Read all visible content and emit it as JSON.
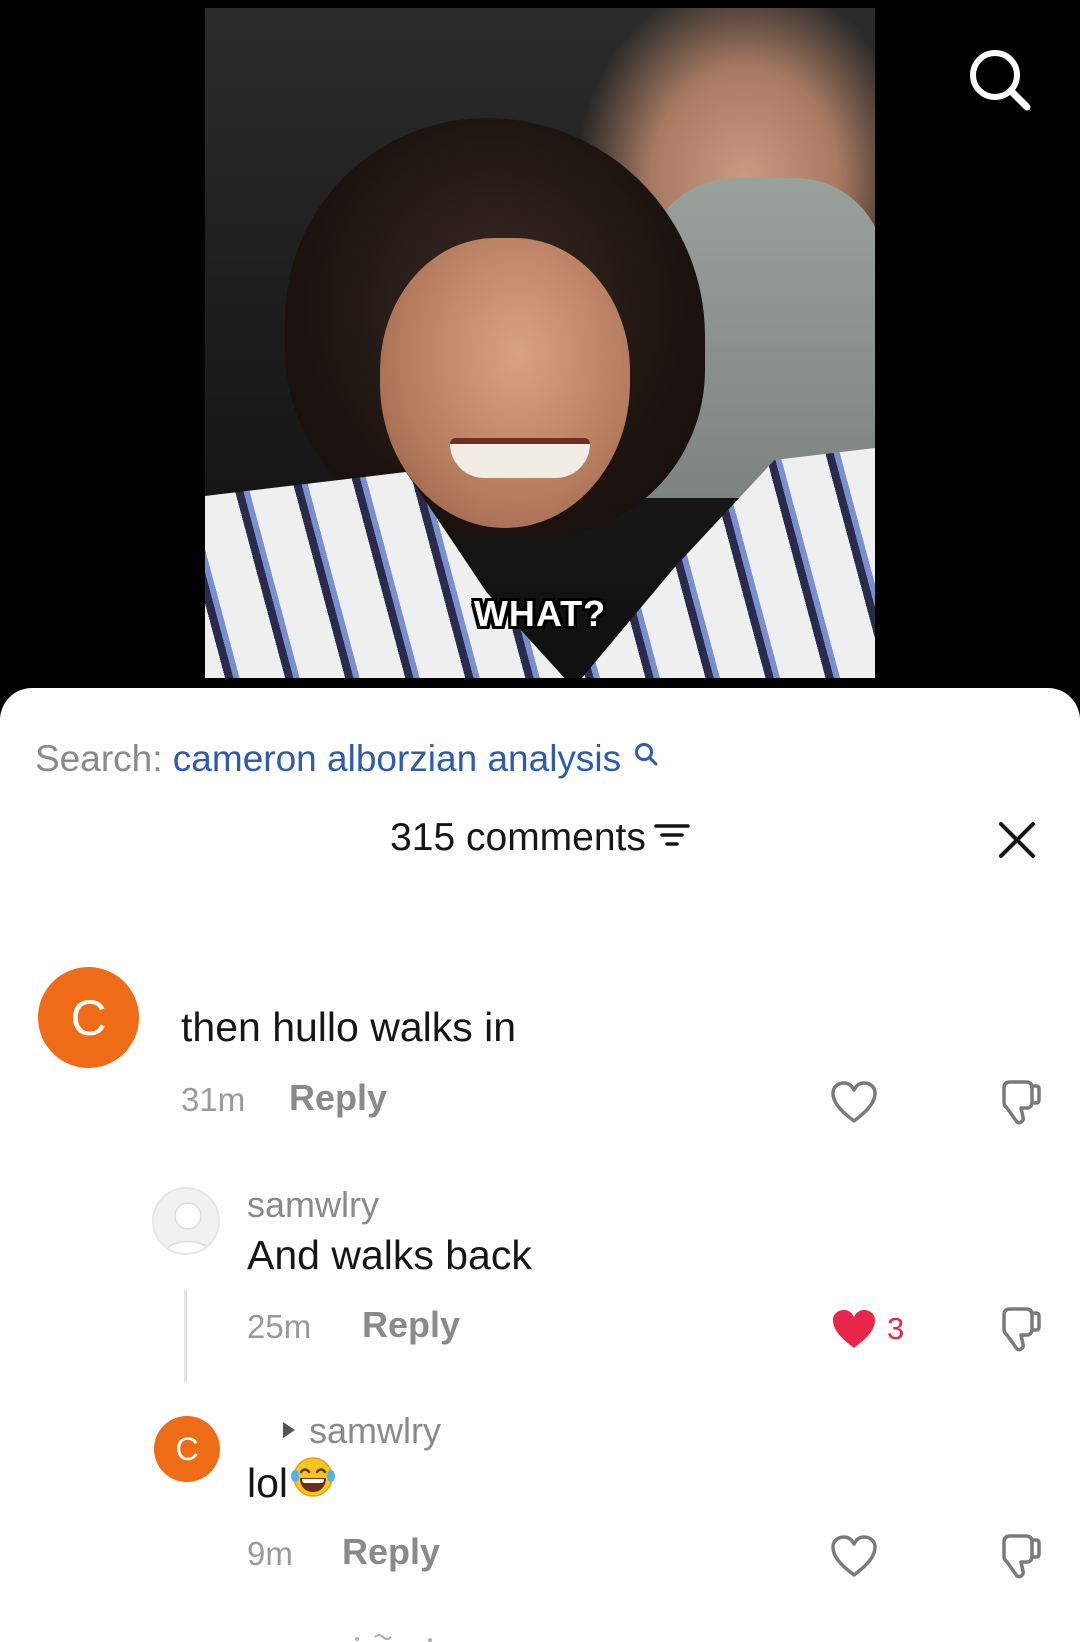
{
  "video": {
    "caption": "WHAT?"
  },
  "sheet": {
    "search_prefix": "Search:",
    "search_query": "cameron alborzian analysis",
    "comments_count_label": "315 comments"
  },
  "comments": [
    {
      "avatar_letter": "C",
      "text": "then hullo walks in",
      "time": "31m",
      "reply_label": "Reply"
    },
    {
      "username": "samwlry",
      "text": "And walks back",
      "time": "25m",
      "reply_label": "Reply",
      "like_count": "3"
    },
    {
      "avatar_letter": "C",
      "reply_to": "samwlry",
      "text": "lol",
      "time": "9m",
      "reply_label": "Reply"
    }
  ],
  "colors": {
    "avatar_orange": "#ef6c17",
    "search_link": "#2e5bae",
    "like_red": "#e8264a"
  },
  "icons": [
    "search-icon",
    "magnifier-small-icon",
    "sort-icon",
    "close-icon",
    "heart-outline-icon",
    "heart-filled-icon",
    "dislike-icon",
    "laughing-emoji-icon",
    "default-avatar-icon",
    "caret-right-icon"
  ]
}
